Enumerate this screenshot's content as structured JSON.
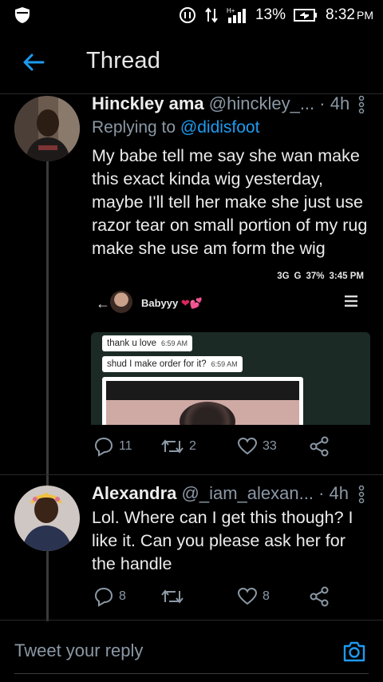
{
  "status_bar": {
    "battery": "13%",
    "time": "8:32",
    "ampm": "PM",
    "network": "H+"
  },
  "app_bar": {
    "title": "Thread"
  },
  "tweets": [
    {
      "name": "Hinckley ama",
      "handle": "@hinckley_...",
      "time": "· 4h",
      "replying_prefix": "Replying to",
      "replying_to": "@didisfoot",
      "body": "My babe tell me say she wan make this exact kinda wig yesterday, maybe I'll tell her make she just use razor tear on small portion of my rug make she use am form the wig",
      "replies": "11",
      "retweets": "2",
      "likes": "33"
    },
    {
      "name": "Alexandra",
      "handle": "@_iam_alexan...",
      "time": "· 4h",
      "body": "Lol. Where can I get this though? I like it. Can you please ask her for the handle",
      "replies": "8",
      "retweets": "",
      "likes": "8"
    }
  ],
  "media": {
    "status_network": "3G",
    "status_g": "G",
    "status_battery": "37%",
    "status_time": "3:45 PM",
    "contact_name": "Babyyy",
    "messages": [
      {
        "text": "thank u love",
        "time": "6:59 AM"
      },
      {
        "text": "shud I make order for it?",
        "time": "6:59 AM"
      }
    ]
  },
  "reply_box": {
    "placeholder": "Tweet your reply"
  },
  "colors": {
    "accent": "#1d9bf0",
    "muted": "#8b98a5",
    "background": "#000000"
  }
}
